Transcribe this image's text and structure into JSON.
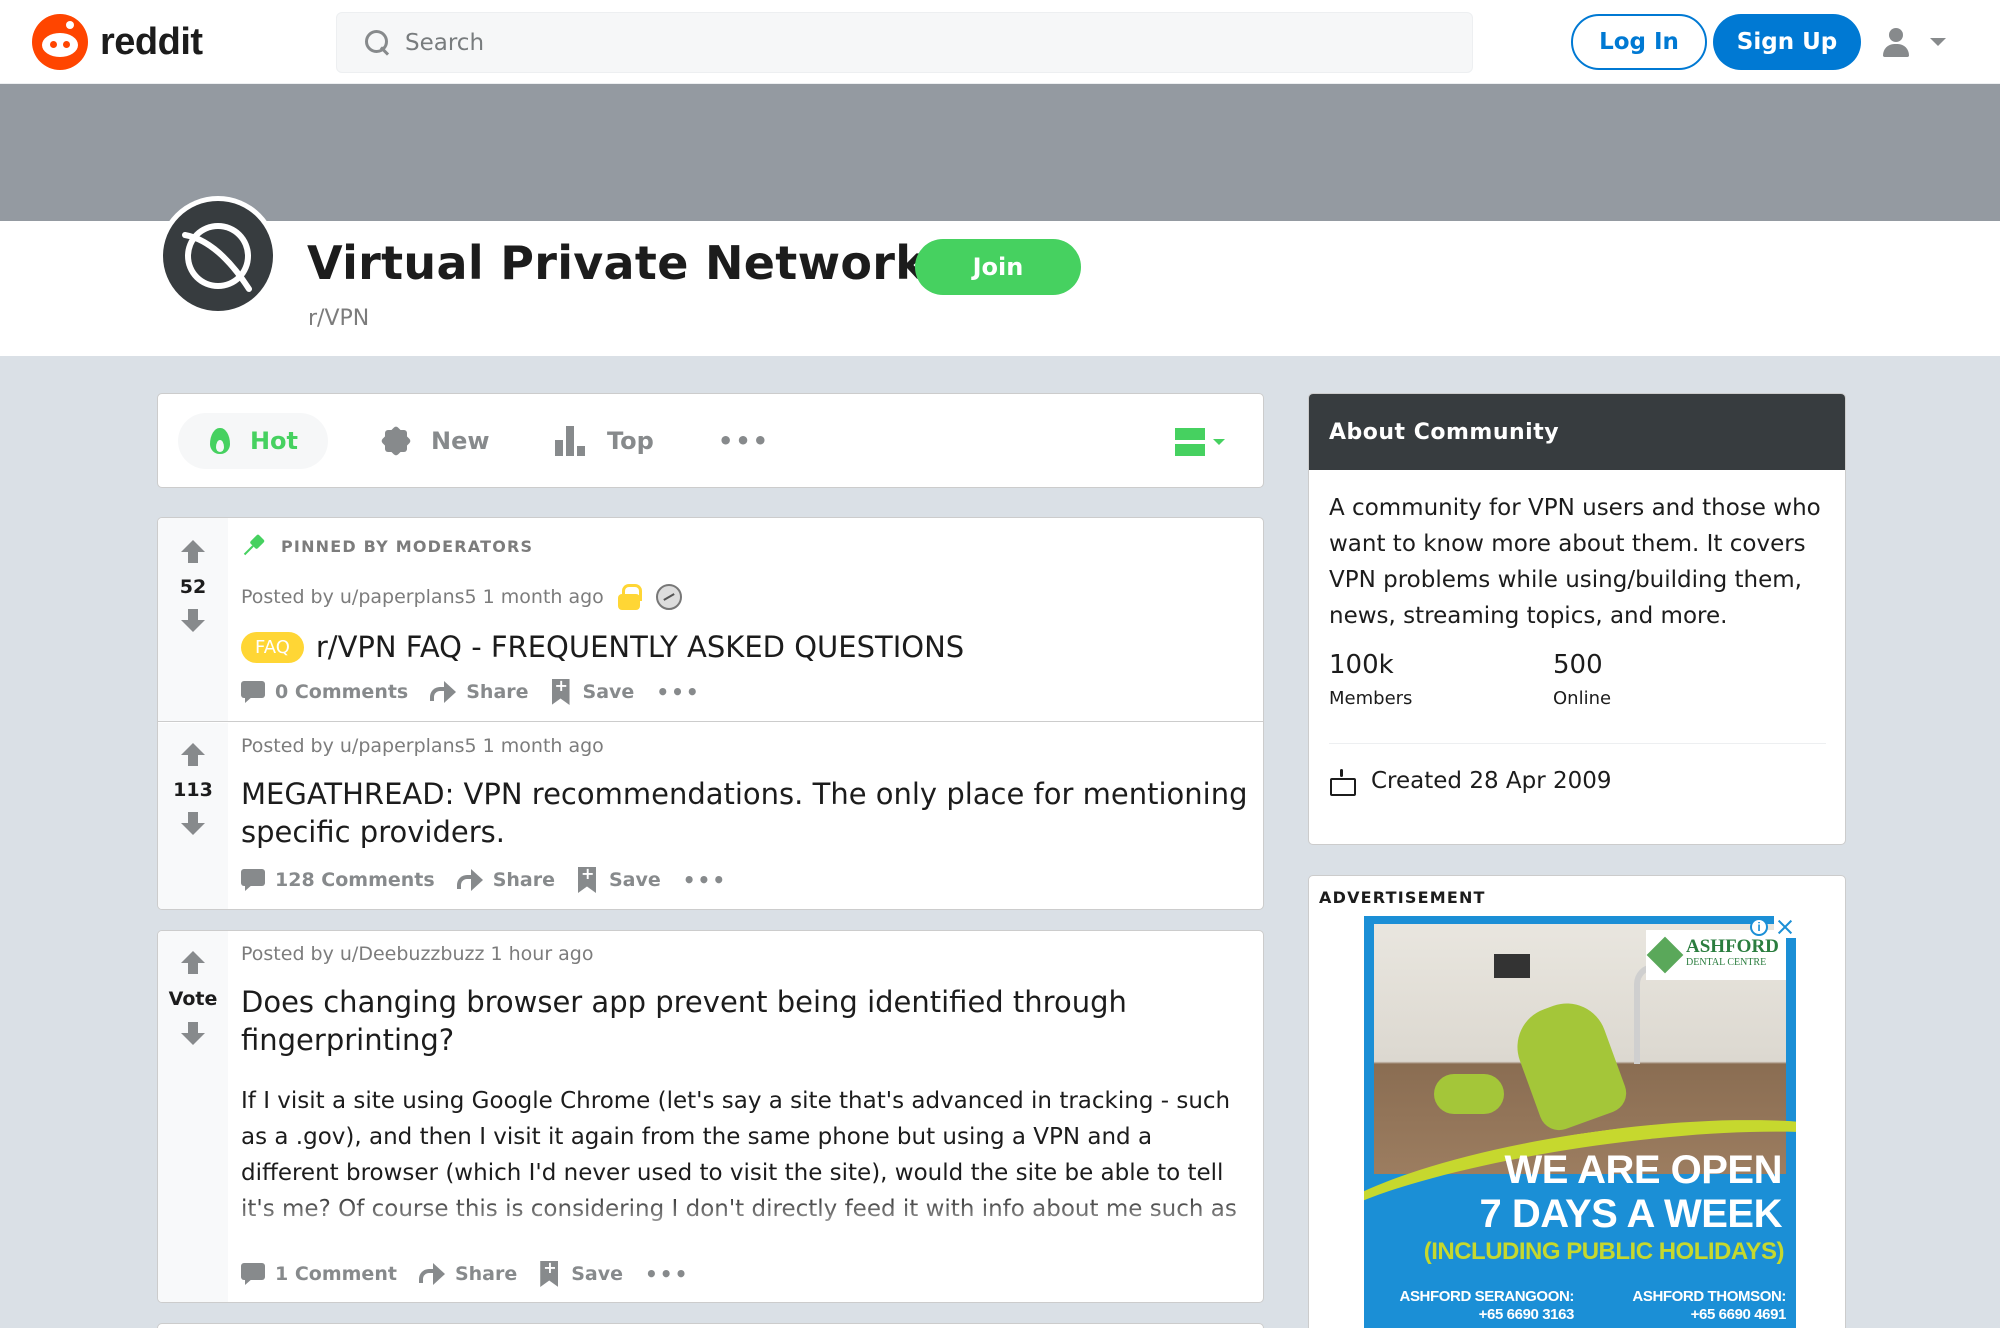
{
  "header": {
    "logo_text": "reddit",
    "search_placeholder": "Search",
    "login_label": "Log In",
    "signup_label": "Sign Up"
  },
  "subreddit": {
    "title": "Virtual Private Networks",
    "name": "r/VPN",
    "join_label": "Join"
  },
  "sort": {
    "hot": "Hot",
    "new": "New",
    "top": "Top",
    "more": "•••"
  },
  "posts": [
    {
      "pinned_label": "PINNED BY MODERATORS",
      "score": "52",
      "posted": "Posted by u/paperplans5 1 month ago",
      "flair": "FAQ",
      "title": "r/VPN FAQ - FREQUENTLY ASKED QUESTIONS",
      "comments": "0 Comments",
      "share": "Share",
      "save": "Save",
      "more": "•••"
    },
    {
      "score": "113",
      "posted": "Posted by u/paperplans5 1 month ago",
      "title": "MEGATHREAD: VPN recommendations. The only place for mentioning specific providers.",
      "comments": "128 Comments",
      "share": "Share",
      "save": "Save",
      "more": "•••"
    },
    {
      "score": "Vote",
      "posted": "Posted by u/Deebuzzbuzz 1 hour ago",
      "title": "Does changing browser app prevent being identified through fingerprinting?",
      "body": "If I visit a site using Google Chrome (let's say a site that's advanced in tracking - such as a .gov), and then I visit it again from the same phone but using a VPN and a different browser (which I'd never used to visit the site), would the site be able to tell it's me? Of course this is considering I don't directly feed it with info about me such as credentials.",
      "comments": "1 Comment",
      "share": "Share",
      "save": "Save",
      "more": "•••"
    }
  ],
  "about": {
    "heading": "About Community",
    "description": "A community for VPN users and those who want to know more about them. It covers VPN problems while using/building them, news, streaming topics, and more.",
    "members_value": "100k",
    "members_label": "Members",
    "online_value": "500",
    "online_label": "Online",
    "created": "Created 28 Apr 2009"
  },
  "ad": {
    "label": "ADVERTISEMENT",
    "brand": "ASHFORD",
    "brand_sub": "DENTAL CENTRE",
    "headline_1": "WE ARE OPEN",
    "headline_2": "7 DAYS A WEEK",
    "subline": "(INCLUDING PUBLIC HOLIDAYS)",
    "branch_1_name": "ASHFORD SERANGOON:",
    "branch_1_phone": "+65 6690 3163",
    "branch_2_name": "ASHFORD THOMSON:",
    "branch_2_phone": "+65 6690 4691",
    "info_glyph": "i"
  },
  "colors": {
    "brand_orange": "#ff4500",
    "blue": "#0079d3",
    "green": "#46d160",
    "flair_yellow": "#ffd635",
    "banner_gray": "#949aa1",
    "about_header": "#373c3f"
  }
}
